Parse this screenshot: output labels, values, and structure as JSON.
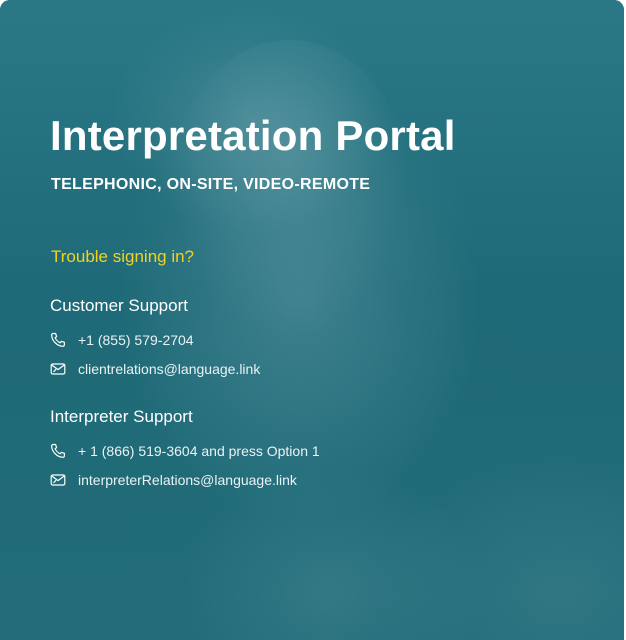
{
  "portal": {
    "title": "Interpretation Portal",
    "subtitle": "TELEPHONIC, ON-SITE, VIDEO-REMOTE",
    "trouble_text": "Trouble signing in?"
  },
  "customer_support": {
    "heading": "Customer Support",
    "phone": "+1 (855) 579-2704",
    "email": "clientrelations@language.link"
  },
  "interpreter_support": {
    "heading": "Interpreter Support",
    "phone": "+ 1 (866) 519-3604 and press Option 1",
    "email": "interpreterRelations@language.link"
  },
  "icons": {
    "phone": "phone-icon",
    "email": "email-icon"
  },
  "colors": {
    "panel_background": "#1f6a78",
    "accent_yellow": "#f2d21f",
    "text_white": "#ffffff"
  }
}
